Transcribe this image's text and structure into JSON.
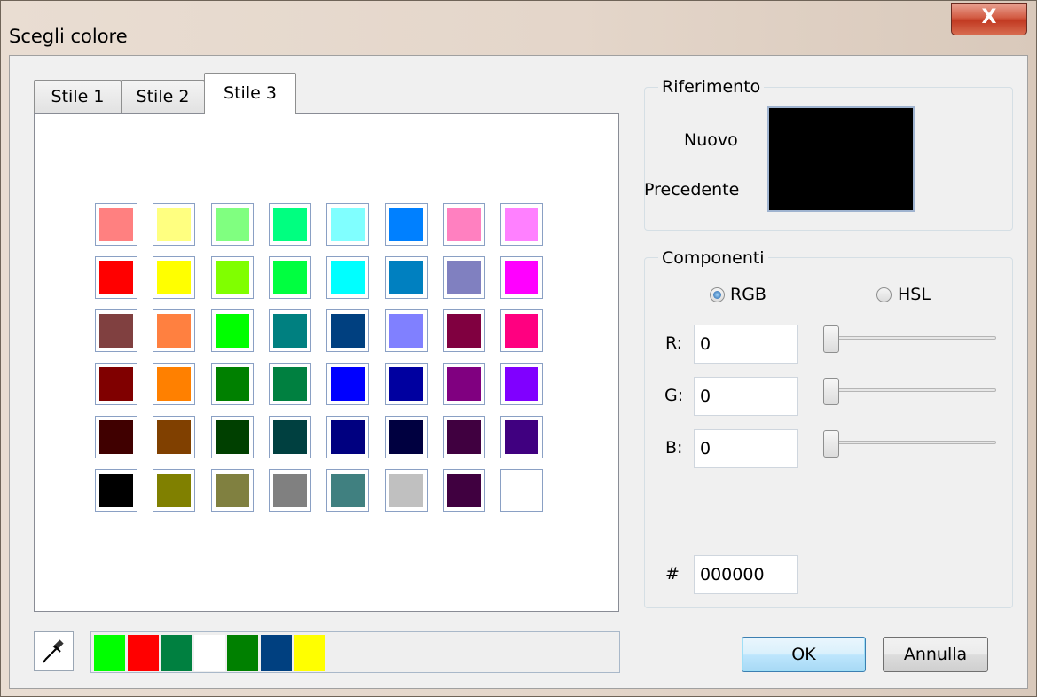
{
  "window": {
    "title": "Scegli colore",
    "close_label": "X"
  },
  "tabs": [
    {
      "label": "Stile 1"
    },
    {
      "label": "Stile 2"
    },
    {
      "label": "Stile 3"
    }
  ],
  "palette": [
    [
      "#ff8080",
      "#ffff80",
      "#80ff80",
      "#00ff80",
      "#80ffff",
      "#0080ff",
      "#ff80c0",
      "#ff80ff"
    ],
    [
      "#ff0000",
      "#ffff00",
      "#80ff00",
      "#00ff40",
      "#00ffff",
      "#0080c0",
      "#8080c0",
      "#ff00ff"
    ],
    [
      "#804040",
      "#ff8040",
      "#00ff00",
      "#008080",
      "#004080",
      "#8080ff",
      "#800040",
      "#ff0080"
    ],
    [
      "#800000",
      "#ff8000",
      "#008000",
      "#008040",
      "#0000ff",
      "#0000a0",
      "#800080",
      "#8000ff"
    ],
    [
      "#400000",
      "#804000",
      "#004000",
      "#004040",
      "#000080",
      "#000040",
      "#400040",
      "#400080"
    ],
    [
      "#000000",
      "#808000",
      "#808040",
      "#808080",
      "#408080",
      "#c0c0c0",
      "#400040",
      ""
    ]
  ],
  "reference": {
    "legend": "Riferimento",
    "new_label": "Nuovo",
    "previous_label": "Precedente",
    "new_color": "#000000",
    "previous_color": "#000000"
  },
  "components": {
    "legend": "Componenti",
    "mode_rgb": "RGB",
    "mode_hsl": "HSL",
    "selected_mode": "RGB",
    "r_label": "R:",
    "g_label": "G:",
    "b_label": "B:",
    "r_value": "0",
    "g_value": "0",
    "b_value": "0",
    "hex_label": "#",
    "hex_value": "000000"
  },
  "recent_colors": [
    "#00ff00",
    "#ff0000",
    "#008040",
    "#ffffff",
    "#008000",
    "#004080",
    "#ffff00"
  ],
  "buttons": {
    "ok": "OK",
    "cancel": "Annulla"
  }
}
